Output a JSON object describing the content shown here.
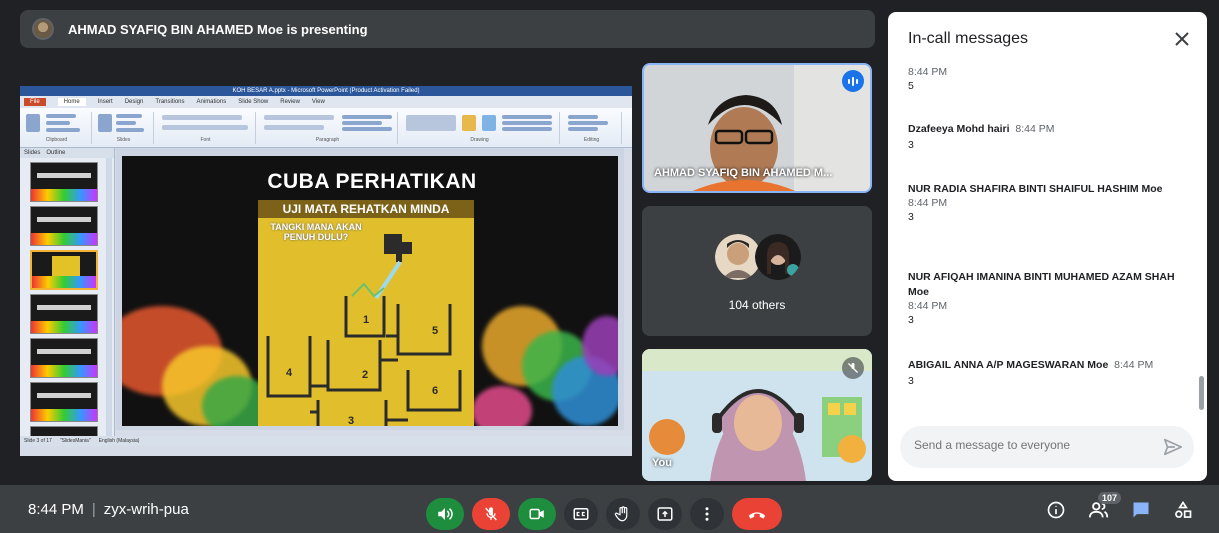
{
  "presenter_banner": {
    "text": "AHMAD SYAFIQ BIN AHAMED Moe is presenting"
  },
  "shared_screen": {
    "window_title": "KOH BESAR A.pptx - Microsoft PowerPoint (Product Activation Failed)",
    "ribbon_tabs": [
      "File",
      "Home",
      "Insert",
      "Design",
      "Transitions",
      "Animations",
      "Slide Show",
      "Review",
      "View"
    ],
    "ribbon_groups": [
      "Clipboard",
      "Slides",
      "Font",
      "Paragraph",
      "Drawing",
      "Editing"
    ],
    "panel_tabs": [
      "Slides",
      "Outline"
    ],
    "slide_numbers": [
      "1",
      "2",
      "3",
      "4",
      "5",
      "6",
      "7"
    ],
    "slide": {
      "title": "CUBA PERHATIKAN",
      "subtitle": "UJI MATA REHATKAN MINDA",
      "question": "TANGKI MANA AKAN PENUH DULU?",
      "tanks": [
        "1",
        "2",
        "3",
        "4",
        "5",
        "6"
      ]
    },
    "status": [
      "Slide 3 of 17",
      "\"SlidesMania\"",
      "English (Malaysia)"
    ]
  },
  "tiles": {
    "speaker_name": "AHMAD SYAFIQ BIN AHAMED M...",
    "others_label": "104 others",
    "self_label": "You"
  },
  "chat": {
    "title": "In-call messages",
    "messages": [
      {
        "sender": "",
        "time": "8:44 PM",
        "body": "5"
      },
      {
        "sender": "Dzafeeya Mohd hairi",
        "time": "8:44 PM",
        "body": "3"
      },
      {
        "sender": "NUR RADIA SHAFIRA BINTI SHAIFUL HASHIM Moe",
        "time": "8:44 PM",
        "body": "3"
      },
      {
        "sender": "NUR AFIQAH IMANINA BINTI MUHAMED AZAM SHAH Moe",
        "time": "8:44 PM",
        "body": "3"
      },
      {
        "sender": "ABIGAIL ANNA A/P MAGESWARAN Moe",
        "time": "8:44 PM",
        "body": "3"
      }
    ],
    "input_placeholder": "Send a message to everyone"
  },
  "bottom_bar": {
    "time": "8:44 PM",
    "meeting_code": "zyx-wrih-pua",
    "participant_count": "107"
  },
  "icons": {
    "audio": "volume-icon",
    "mic": "mic-off-icon",
    "camera": "camera-icon",
    "captions": "captions-icon",
    "hand": "raise-hand-icon",
    "present": "present-icon",
    "more": "more-vert-icon",
    "end": "end-call-icon"
  },
  "colors": {
    "accent": "#1a73e8",
    "green": "#1e8e3e",
    "red": "#ea4335",
    "bar": "#3c4043"
  }
}
